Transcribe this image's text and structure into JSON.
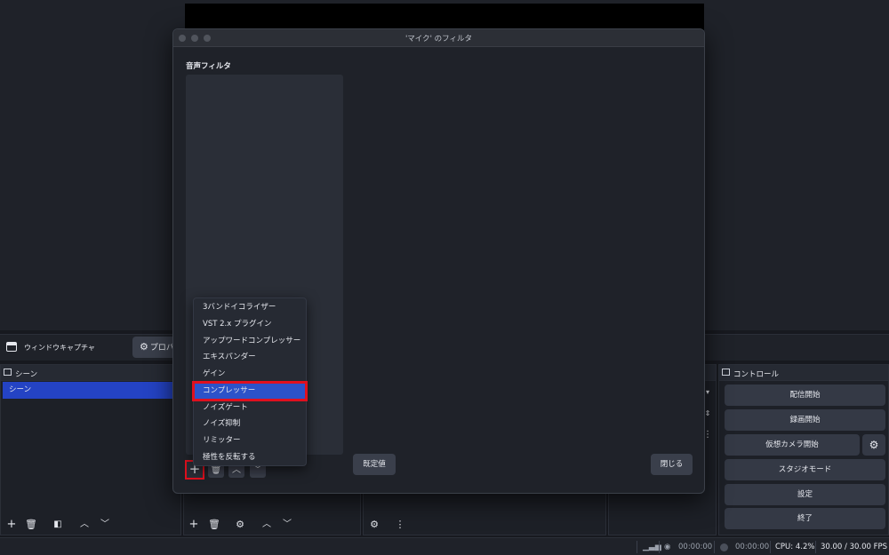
{
  "main": {
    "source_toolbar": {
      "source_name": "ウィンドウキャプチャ",
      "properties_label": "プロパ"
    },
    "scenes": {
      "title": "シーン",
      "items": [
        "シーン"
      ]
    },
    "controls": {
      "title": "コントロール",
      "buttons": [
        "配信開始",
        "録画開始",
        "仮想カメラ開始",
        "スタジオモード",
        "設定",
        "終了"
      ]
    },
    "status": {
      "stream_time": "00:00:00",
      "rec_time": "00:00:00",
      "cpu": "CPU: 4.2%",
      "fps": "30.00 / 30.00 FPS"
    }
  },
  "dialog": {
    "title": "'マイク' のフィルタ",
    "section_label": "音声フィルタ",
    "defaults_button": "既定値",
    "close_button": "閉じる"
  },
  "menu": {
    "items": [
      "3バンドイコライザー",
      "VST 2.x プラグイン",
      "アップワードコンプレッサー",
      "エキスパンダー",
      "ゲイン",
      "コンプレッサー",
      "ノイズゲート",
      "ノイズ抑制",
      "リミッター",
      "極性を反転する"
    ],
    "selected_index": 5
  },
  "colors": {
    "accent": "#2443c4",
    "highlight": "#e0101e",
    "menu_selected": "#2c52c9"
  }
}
